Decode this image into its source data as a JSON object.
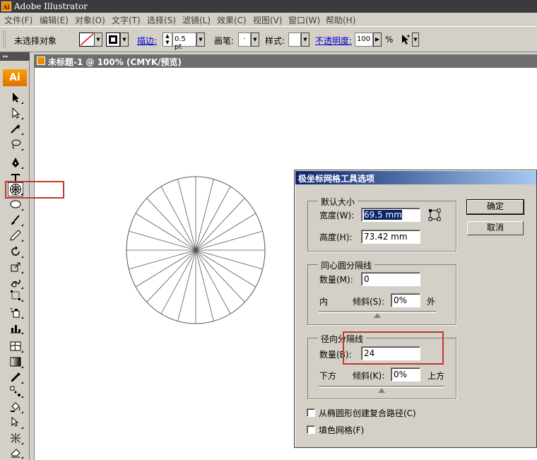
{
  "app": {
    "title": "Adobe Illustrator",
    "logo_text": "Ai"
  },
  "menu": [
    "文件(F)",
    "编辑(E)",
    "对象(O)",
    "文字(T)",
    "选择(S)",
    "滤镜(L)",
    "效果(C)",
    "视图(V)",
    "窗口(W)",
    "帮助(H)"
  ],
  "control_bar": {
    "selection_status": "未选择对象",
    "stroke_link": "描边:",
    "stroke_weight": "0.5 pt",
    "brush_label": "画笔:",
    "brush_value": "·",
    "style_label": "样式:",
    "opacity_link": "不透明度:",
    "opacity_value": "100",
    "opacity_unit": "%"
  },
  "tools": {
    "badge": "Ai",
    "selected_tool": "polar-grid-tool"
  },
  "document": {
    "tab_title": "未标题-1 @ 100% (CMYK/预览)",
    "polar_grid_radial_dividers": 24
  },
  "dialog": {
    "title": "极坐标网格工具选项",
    "default_size": {
      "legend": "默认大小",
      "width_label": "宽度(W):",
      "width_value": "69.5 mm",
      "height_label": "高度(H):",
      "height_value": "73.42 mm"
    },
    "concentric": {
      "legend": "同心圆分隔线",
      "count_label": "数量(M):",
      "count_value": "0",
      "inner_label": "内",
      "skew_label": "倾斜(S):",
      "skew_value": "0%",
      "outer_label": "外",
      "skew_fraction": 0.5
    },
    "radial": {
      "legend": "径向分隔线",
      "count_label": "数量(B):",
      "count_value": "24",
      "bottom_label": "下方",
      "skew_label": "倾斜(K):",
      "skew_value": "0%",
      "top_label": "上方",
      "skew_fraction": 0.5
    },
    "ok_label": "确定",
    "cancel_label": "取消",
    "compound_path_label": "从椭圆形创建复合路径(C)",
    "fill_grid_label": "填色网格(F)",
    "compound_path_checked": false,
    "fill_grid_checked": false
  },
  "colors": {
    "highlight": "#c0392b",
    "dialog_title_start": "#0a246a",
    "accent_orange": "#f08a00"
  }
}
